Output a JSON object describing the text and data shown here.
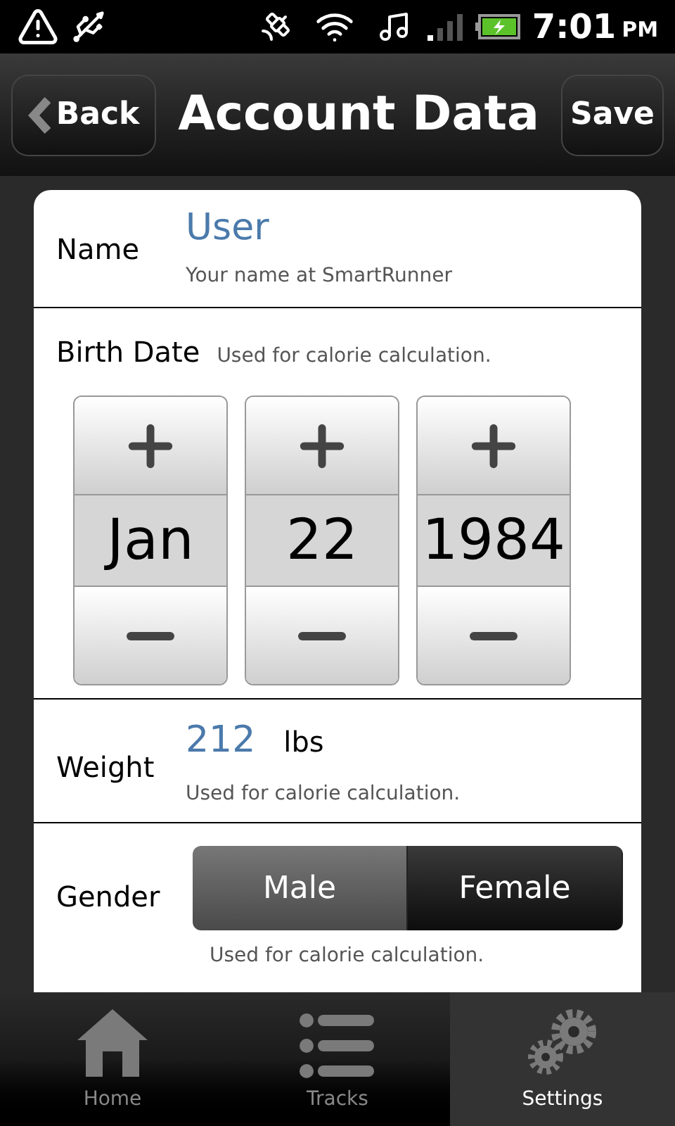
{
  "status_bar": {
    "time": "7:01",
    "ampm": "PM"
  },
  "header": {
    "back": "Back",
    "title": "Account Data",
    "save": "Save"
  },
  "name": {
    "label": "Name",
    "value": "User",
    "hint": "Your name at SmartRunner"
  },
  "birth_date": {
    "label": "Birth Date",
    "hint": "Used for calorie calculation.",
    "spinners": [
      {
        "value": "Jan"
      },
      {
        "value": "22"
      },
      {
        "value": "1984"
      }
    ]
  },
  "weight": {
    "label": "Weight",
    "value": "212",
    "unit": "lbs",
    "hint": "Used for calorie calculation."
  },
  "gender": {
    "label": "Gender",
    "options": [
      {
        "label": "Male",
        "selected": false
      },
      {
        "label": "Female",
        "selected": true
      }
    ],
    "hint": "Used for calorie calculation."
  },
  "tabs": [
    {
      "label": "Home",
      "kind": "home",
      "selected": false
    },
    {
      "label": "Tracks",
      "kind": "list",
      "selected": false
    },
    {
      "label": "Settings",
      "kind": "gears",
      "selected": true
    }
  ]
}
